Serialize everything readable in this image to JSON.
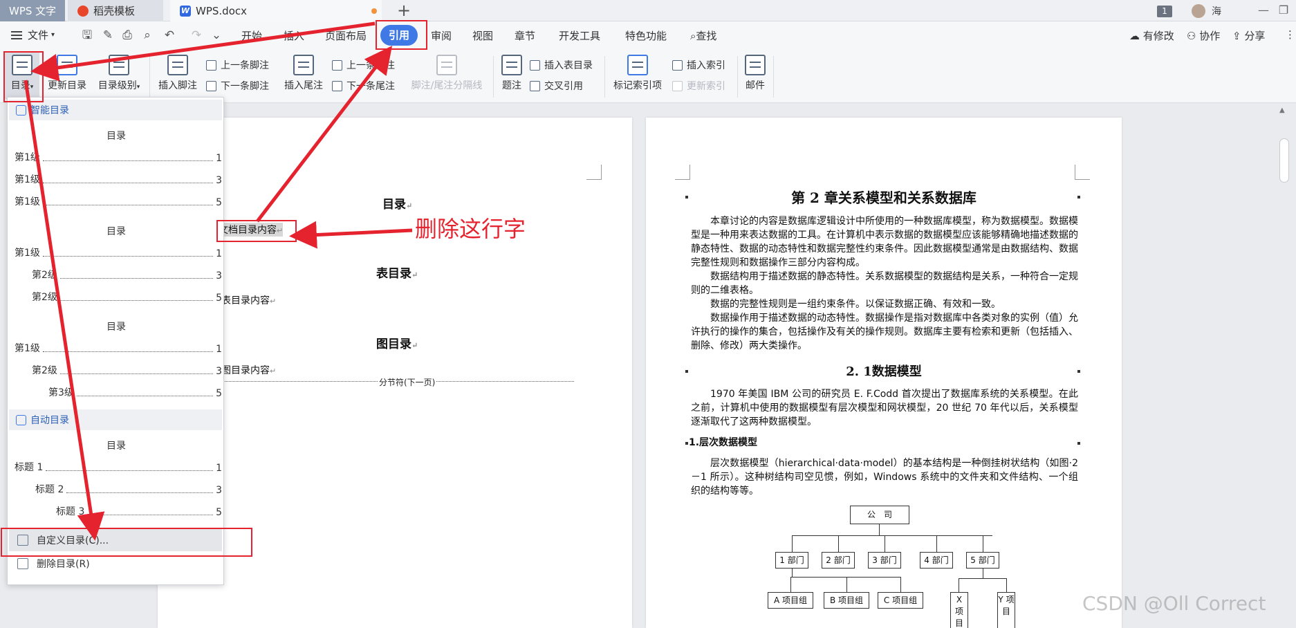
{
  "titlebar": {
    "app_tab": "WPS 文字",
    "template_tab": "稻壳模板",
    "doc_tab": "WPS.docx",
    "new_tab": "+",
    "notification_count": "1",
    "user_name": "海"
  },
  "menubar": {
    "file": "文件",
    "tabs": [
      "开始",
      "插入",
      "页面布局",
      "引用",
      "审阅",
      "视图",
      "章节",
      "开发工具",
      "特色功能",
      "查找"
    ],
    "active_tab": "引用",
    "right": {
      "changes": "有修改",
      "collab": "协作",
      "share": "分享"
    }
  },
  "ribbon": {
    "toc": "目录",
    "update_toc": "更新目录",
    "toc_level": "目录级别",
    "insert_footnote": "插入脚注",
    "prev_footnote": "上一条脚注",
    "next_footnote": "下一条脚注",
    "insert_endnote": "插入尾注",
    "prev_endnote": "上一条尾注",
    "next_endnote": "下一条尾注",
    "note_separator": "脚注/尾注分隔线",
    "caption": "题注",
    "insert_table_of_figures": "插入表目录",
    "cross_reference": "交叉引用",
    "mark_index_entry": "标记索引项",
    "insert_index": "插入索引",
    "update_index": "更新索引",
    "mail": "邮件"
  },
  "toc_menu": {
    "smart_toc": "智能目录",
    "group1": {
      "title": "目录",
      "entries": [
        {
          "label": "第1级",
          "page": "1"
        },
        {
          "label": "第1级",
          "page": "3"
        },
        {
          "label": "第1级",
          "page": "5"
        }
      ]
    },
    "group2": {
      "title": "目录",
      "entries": [
        {
          "label": "第1级",
          "page": "1"
        },
        {
          "label": "第2级",
          "page": "3"
        },
        {
          "label": "第2级",
          "page": "5"
        }
      ]
    },
    "group3": {
      "title": "目录",
      "entries": [
        {
          "label": "第1级",
          "page": "1"
        },
        {
          "label": "第2级",
          "page": "3"
        },
        {
          "label": "第3级",
          "page": "5"
        }
      ]
    },
    "auto_toc": "自动目录",
    "group4": {
      "title": "目录",
      "entries": [
        {
          "label": "标题 1",
          "page": "1"
        },
        {
          "label": "标题 2",
          "page": "3"
        },
        {
          "label": "标题 3",
          "page": "5"
        }
      ]
    },
    "custom_toc": "自定义目录(C)...",
    "delete_toc": "删除目录(R)"
  },
  "page1": {
    "toc_heading": "目录",
    "toc_placeholder": "文档目录内容",
    "table_heading": "表目录",
    "table_placeholder": "表目录内容",
    "figure_heading": "图目录",
    "figure_placeholder": "图目录内容",
    "section_break": "分节符(下一页)"
  },
  "page2": {
    "chapter_title": "第 2 章关系模型和关系数据库",
    "para1": "本章讨论的内容是数据库逻辑设计中所使用的一种数据库模型，称为数据模型。数据模型是一种用来表达数据的工具。在计算机中表示数据的数据模型应该能够精确地描述数据的静态特性、数据的动态特性和数据完整性约束条件。因此数据模型通常是由数据结构、数据完整性规则和数据操作三部分内容构成。",
    "para2": "数据结构用于描述数据的静态特性。关系数据模型的数据结构是关系，一种符合一定规则的二维表格。",
    "para3": "数据的完整性规则是一组约束条件。以保证数据正确、有效和一致。",
    "para4": "数据操作用于描述数据的动态特性。数据操作是指对数据库中各类对象的实例（值）允许执行的操作的集合，包括操作及有关的操作规则。数据库主要有检索和更新（包括插入、删除、修改）两大类操作。",
    "section_title": "2. 1数据模型",
    "para5": "1970 年美国 IBM 公司的研究员 E. F.Codd 首次提出了数据库系统的关系模型。在此之前，计算机中使用的数据模型有层次模型和网状模型，20 世纪 70 年代以后，关系模型逐渐取代了这两种数据模型。",
    "sub_title": "1.层次数据模型",
    "para6": "层次数据模型（hierarchical·data·model）的基本结构是一种倒挂树状结构（如图·2－1 所示）。这种树结构司空见惯，例如，Windows 系统中的文件夹和文件结构、一个组织的结构等等。",
    "org": {
      "root": "公　司",
      "depts": [
        "1 部门",
        "2 部门",
        "3 部门",
        "4 部门",
        "5 部门"
      ],
      "groups": [
        "A 项目组",
        "B 项目组",
        "C 项目组"
      ],
      "sub": [
        "X 项 目",
        "Y 项 目"
      ]
    }
  },
  "annotation": {
    "text": "删除这行字",
    "color": "#e5232f"
  },
  "watermark": "CSDN @Oll Correct"
}
